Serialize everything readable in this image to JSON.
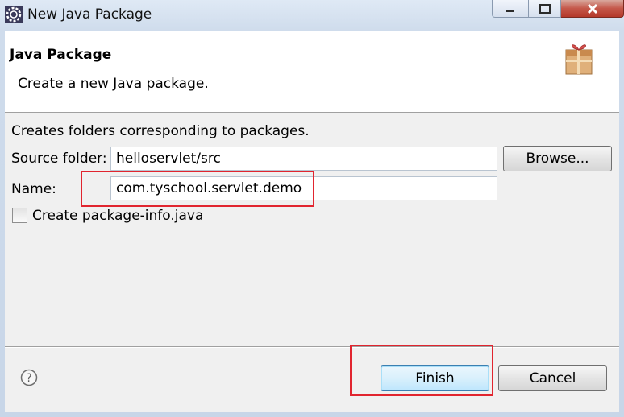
{
  "window": {
    "title": "New Java Package",
    "app_icon": "eclipse-gear-icon",
    "controls": [
      "minimize-icon",
      "maximize-icon",
      "close-icon"
    ]
  },
  "banner": {
    "title": "Java Package",
    "message": "Create a new Java package.",
    "icon": "package-icon"
  },
  "form": {
    "description": "Creates folders corresponding to packages.",
    "source_folder_label": "Source folder:",
    "source_folder_value": "helloservlet/src",
    "browse_label": "Browse...",
    "name_label": "Name:",
    "name_value": "com.tyschool.servlet.demo",
    "package_info_label": "Create package-info.java",
    "package_info_checked": false
  },
  "footer": {
    "help_icon": "help-icon",
    "finish_label": "Finish",
    "cancel_label": "Cancel"
  },
  "colors": {
    "highlight_box": "#e1252f",
    "default_button_border": "#3c7fb1"
  }
}
